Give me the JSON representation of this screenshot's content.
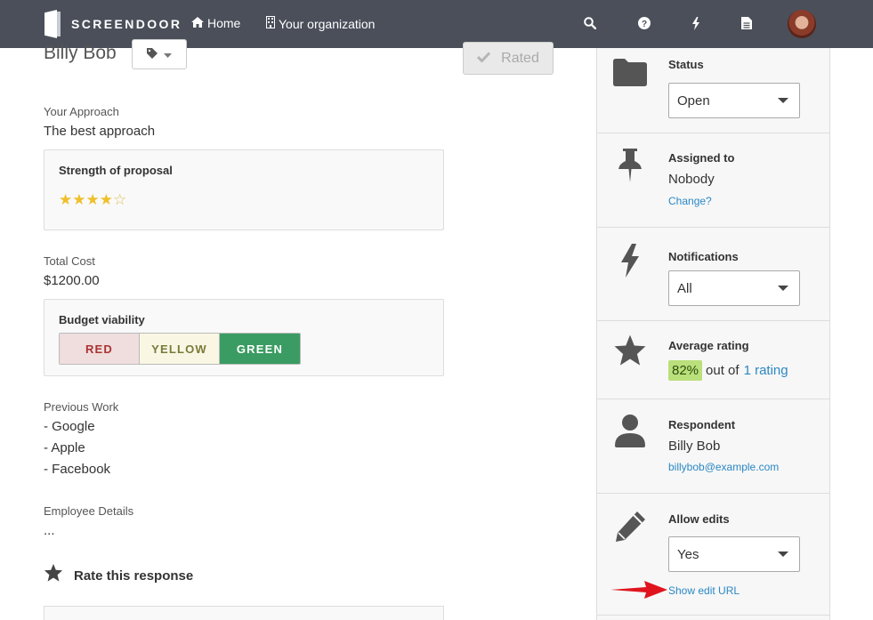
{
  "nav": {
    "brand": "SCREENDOOR",
    "home_label": "Home",
    "org_label": "Your organization",
    "icons": [
      "search-icon",
      "help-icon",
      "bolt-icon",
      "document-icon"
    ]
  },
  "response": {
    "name": "Billy Bob",
    "rated_label": "Rated"
  },
  "fields": {
    "approach_label": "Your Approach",
    "approach_value": "The best approach",
    "strength_title": "Strength of proposal",
    "strength_rating": 4,
    "strength_max": 5,
    "cost_label": "Total Cost",
    "cost_value": "$1200.00",
    "budget_title": "Budget viability",
    "budget_options": [
      "RED",
      "YELLOW",
      "GREEN"
    ],
    "budget_selected": "GREEN",
    "previous_label": "Previous Work",
    "previous_items": [
      "- Google",
      "- Apple",
      "- Facebook"
    ],
    "employee_label": "Employee Details",
    "employee_value": "...",
    "rate_label": "Rate this response"
  },
  "sidebar": {
    "status_title": "Status",
    "status_value": "Open",
    "assigned_title": "Assigned to",
    "assigned_value": "Nobody",
    "assigned_link": "Change?",
    "notif_title": "Notifications",
    "notif_value": "All",
    "avg_title": "Average rating",
    "avg_pct": "82%",
    "avg_middle": "out of",
    "avg_link": "1 rating",
    "respondent_title": "Respondent",
    "respondent_name": "Billy Bob",
    "respondent_email": "billybob@example.com",
    "edits_title": "Allow edits",
    "edits_value": "Yes",
    "edits_link": "Show edit URL"
  },
  "colors": {
    "topbar": "#4a4f5a",
    "link": "#2a88c5",
    "green": "#3a9c62",
    "arrow": "#e0141e"
  }
}
